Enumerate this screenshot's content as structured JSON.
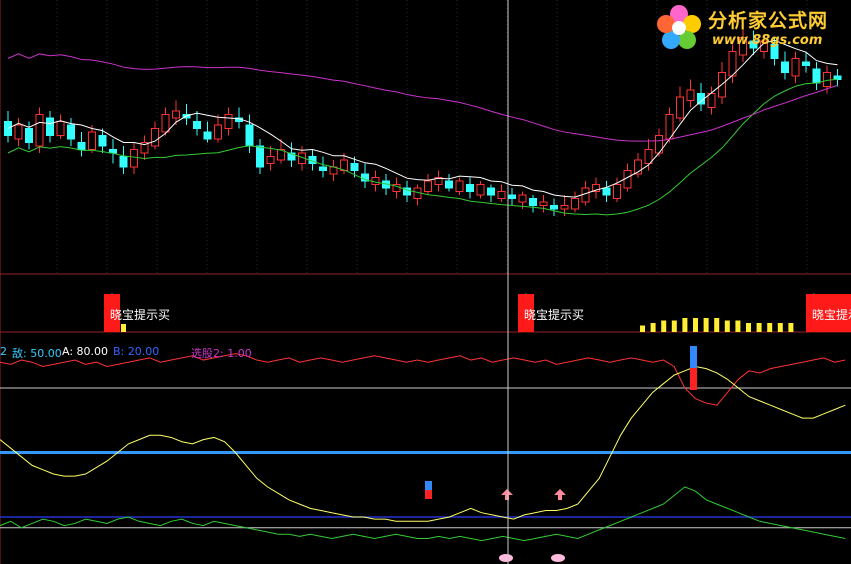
{
  "watermark": {
    "title": "分析家公式网",
    "url": "www.88gs.com"
  },
  "signals": {
    "buy_label": "晓宝提示买"
  },
  "legend": {
    "prefix": "2",
    "di_label": "敌: 50.00",
    "a_label": "A: 80.00",
    "b_label": "B: 20.00",
    "pick_label": "选股2: 1.00"
  },
  "colors": {
    "background": "#000000",
    "up_candle": "#ff3333",
    "down_candle": "#33ffff",
    "ma_short": "#ffffff",
    "ma_mid": "#33cc33",
    "ma_long": "#cc33cc",
    "signal_bar": "#ffee33",
    "signal_box": "#ff1a1a",
    "line_red": "#ff3333",
    "line_yellow": "#ffff66",
    "line_green": "#33cc33",
    "level_blue": "#3399ff"
  },
  "chart_data": [
    {
      "type": "candlestick",
      "title": "",
      "series": [
        {
          "name": "",
          "role": "candles",
          "values": [
            [
              126,
              122,
              129,
              120
            ],
            [
              121,
              125,
              127,
              119
            ],
            [
              124,
              120,
              126,
              118
            ],
            [
              119,
              128,
              130,
              117
            ],
            [
              127,
              122,
              129,
              120
            ],
            [
              122,
              126,
              128,
              121
            ],
            [
              125,
              121,
              127,
              119
            ],
            [
              120,
              118,
              123,
              116
            ],
            [
              118,
              123,
              125,
              117
            ],
            [
              122,
              119,
              124,
              117
            ],
            [
              118,
              117,
              121,
              114
            ],
            [
              116,
              113,
              119,
              111
            ],
            [
              113,
              118,
              120,
              111
            ],
            [
              117,
              120,
              122,
              115
            ],
            [
              119,
              124,
              126,
              118
            ],
            [
              123,
              128,
              130,
              122
            ],
            [
              127,
              129,
              132,
              125
            ],
            [
              128,
              127,
              131,
              125
            ],
            [
              126,
              124,
              129,
              122
            ],
            [
              123,
              121,
              126,
              120
            ],
            [
              121,
              125,
              128,
              120
            ],
            [
              124,
              128,
              130,
              122
            ],
            [
              127,
              126,
              130,
              124
            ],
            [
              125,
              119,
              128,
              117
            ],
            [
              119,
              113,
              121,
              111
            ],
            [
              114,
              116,
              119,
              112
            ],
            [
              115,
              118,
              121,
              114
            ],
            [
              117,
              115,
              120,
              113
            ],
            [
              114,
              117,
              119,
              112
            ],
            [
              116,
              114,
              118,
              112
            ],
            [
              113,
              112,
              116,
              110
            ],
            [
              111,
              113,
              115,
              109
            ],
            [
              112,
              115,
              117,
              111
            ],
            [
              114,
              112,
              116,
              110
            ],
            [
              111,
              109,
              114,
              107
            ],
            [
              108,
              110,
              112,
              106
            ],
            [
              109,
              107,
              111,
              105
            ],
            [
              106,
              108,
              110,
              104
            ],
            [
              107,
              105,
              109,
              103
            ],
            [
              104,
              107,
              108,
              102
            ],
            [
              106,
              109,
              111,
              105
            ],
            [
              108,
              110,
              112,
              106
            ],
            [
              109,
              107,
              111,
              106
            ],
            [
              106,
              109,
              110,
              105
            ],
            [
              108,
              106,
              110,
              104
            ],
            [
              105,
              108,
              109,
              104
            ],
            [
              107,
              105,
              108,
              103
            ],
            [
              104,
              106,
              108,
              103
            ],
            [
              105,
              104,
              107,
              102
            ],
            [
              103,
              105,
              106,
              101
            ],
            [
              104,
              102,
              105,
              100
            ],
            [
              102,
              103,
              105,
              100
            ],
            [
              102,
              101,
              104,
              99
            ],
            [
              101,
              102,
              105,
              99
            ],
            [
              101,
              104,
              106,
              100
            ],
            [
              103,
              107,
              109,
              102
            ],
            [
              106,
              108,
              110,
              104
            ],
            [
              107,
              105,
              109,
              103
            ],
            [
              104,
              108,
              110,
              103
            ],
            [
              107,
              112,
              114,
              106
            ],
            [
              111,
              115,
              117,
              110
            ],
            [
              114,
              118,
              121,
              112
            ],
            [
              117,
              122,
              124,
              116
            ],
            [
              121,
              128,
              130,
              120
            ],
            [
              127,
              133,
              136,
              126
            ],
            [
              132,
              135,
              138,
              130
            ],
            [
              134,
              131,
              137,
              129
            ],
            [
              130,
              134,
              136,
              128
            ],
            [
              133,
              140,
              143,
              131
            ],
            [
              139,
              146,
              148,
              137
            ],
            [
              145,
              150,
              153,
              143
            ],
            [
              149,
              147,
              152,
              145
            ],
            [
              146,
              149,
              151,
              144
            ],
            [
              148,
              144,
              150,
              142
            ],
            [
              143,
              140,
              146,
              138
            ],
            [
              139,
              144,
              146,
              137
            ],
            [
              143,
              142,
              146,
              140
            ],
            [
              141,
              137,
              143,
              135
            ],
            [
              136,
              140,
              142,
              134
            ],
            [
              139,
              138,
              141,
              136
            ]
          ]
        }
      ],
      "overlays": [
        "ma_short",
        "ma_mid",
        "ma_long"
      ]
    },
    {
      "type": "bar",
      "title": "",
      "signal_label": "晓宝提示买",
      "signal_boxes_x": [
        17,
        60,
        81
      ],
      "values": [
        0,
        0,
        0,
        0,
        0,
        0,
        0,
        0,
        0,
        0,
        0,
        0,
        0,
        0,
        0,
        0,
        0,
        0,
        0,
        0,
        0,
        0,
        0,
        0,
        0,
        0,
        0,
        0,
        0,
        0,
        0,
        0,
        0,
        0,
        0,
        0,
        0,
        0,
        0,
        0,
        0,
        0,
        0,
        0,
        0,
        0,
        0,
        0,
        0,
        0,
        0,
        0,
        0,
        0,
        0,
        0,
        0,
        0,
        0,
        0,
        0,
        0,
        0,
        0,
        0,
        0,
        0,
        0,
        0,
        0,
        0,
        0,
        0,
        0,
        0,
        0,
        0,
        0,
        0,
        0
      ],
      "yellow_bars": [
        1,
        2,
        3,
        3,
        4,
        4,
        4,
        4,
        3,
        3,
        2,
        2,
        2,
        2,
        2
      ]
    },
    {
      "type": "line",
      "title": "",
      "levels": {
        "di": 50.0,
        "A": 80.0,
        "B": 20.0
      },
      "ylim": [
        0,
        100
      ],
      "series": [
        {
          "name": "",
          "color": "red",
          "values": [
            92,
            91,
            93,
            92,
            90,
            91,
            92,
            93,
            91,
            92,
            90,
            91,
            92,
            93,
            94,
            92,
            93,
            94,
            95,
            93,
            94,
            95,
            96,
            95,
            93,
            92,
            93,
            94,
            92,
            93,
            94,
            93,
            92,
            93,
            94,
            95,
            94,
            93,
            92,
            93,
            92,
            93,
            94,
            95,
            93,
            94,
            92,
            93,
            94,
            93,
            92,
            93,
            91,
            92,
            93,
            94,
            93,
            92,
            93,
            94,
            93,
            92,
            93,
            90,
            80,
            75,
            73,
            72,
            78,
            84,
            88,
            87,
            89,
            90,
            91,
            92,
            93,
            94,
            92,
            93
          ]
        },
        {
          "name": "",
          "color": "yellow",
          "values": [
            56,
            52,
            48,
            44,
            42,
            40,
            39,
            39,
            40,
            43,
            46,
            50,
            54,
            56,
            58,
            58,
            57,
            55,
            54,
            56,
            57,
            55,
            50,
            44,
            38,
            34,
            31,
            28,
            26,
            24,
            23,
            22,
            21,
            20,
            20,
            19,
            19,
            18,
            18,
            18,
            18,
            19,
            20,
            22,
            24,
            22,
            21,
            20,
            19,
            21,
            22,
            23,
            23,
            24,
            26,
            32,
            38,
            48,
            58,
            66,
            72,
            78,
            82,
            86,
            88,
            90,
            89,
            87,
            84,
            80,
            76,
            74,
            72,
            70,
            68,
            66,
            66,
            68,
            70,
            72
          ]
        },
        {
          "name": "",
          "color": "green",
          "values": [
            16,
            18,
            15,
            17,
            19,
            18,
            16,
            17,
            19,
            18,
            17,
            19,
            20,
            18,
            17,
            16,
            18,
            19,
            17,
            16,
            18,
            17,
            16,
            15,
            14,
            13,
            12,
            12,
            11,
            12,
            11,
            10,
            11,
            12,
            11,
            10,
            11,
            12,
            11,
            10,
            10,
            11,
            10,
            11,
            10,
            9,
            10,
            11,
            10,
            9,
            10,
            11,
            12,
            11,
            10,
            12,
            14,
            16,
            18,
            20,
            22,
            24,
            26,
            30,
            34,
            32,
            28,
            26,
            24,
            22,
            20,
            18,
            17,
            16,
            15,
            14,
            13,
            12,
            11,
            10
          ]
        }
      ]
    }
  ]
}
